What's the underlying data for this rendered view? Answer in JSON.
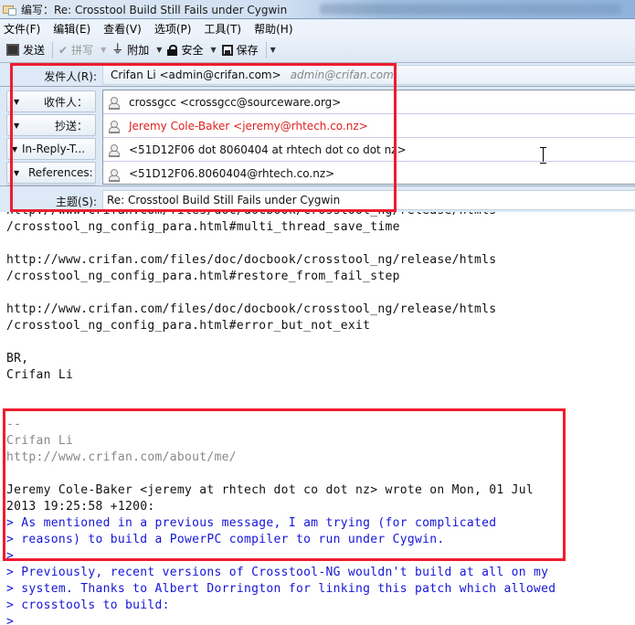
{
  "window": {
    "title": "编写：Re: Crosstool Build Still Fails under Cygwin",
    "app_icon": "compose-envelope-icon"
  },
  "menu": {
    "items": [
      "文件(F)",
      "编辑(E)",
      "查看(V)",
      "选项(P)",
      "工具(T)",
      "帮助(H)"
    ]
  },
  "toolbar": {
    "send_label": "发送",
    "spell_label": "拼写",
    "attach_label": "附加",
    "security_label": "安全",
    "save_label": "保存",
    "dropdown_glyph": "▼"
  },
  "header": {
    "from_label": "发件人(R):",
    "from_value": "Crifan Li <admin@crifan.com>",
    "from_alt": "admin@crifan.com",
    "recipients": [
      {
        "type_label": "收件人：",
        "value": "crossgcc <crossgcc@sourceware.org>",
        "highlight": false
      },
      {
        "type_label": "抄送：",
        "value": "Jeremy Cole-Baker <jeremy@rhtech.co.nz>",
        "highlight": true
      },
      {
        "type_label": "In-Reply-T...",
        "value": "<51D12F06 dot 8060404 at rhtech dot co dot nz>",
        "highlight": false
      },
      {
        "type_label": "References:",
        "value": "<51D12F06.8060404@rhtech.co.nz>",
        "highlight": false
      }
    ],
    "subject_label": "主题(S):",
    "subject_value": "Re: Crosstool Build Still Fails under Cygwin"
  },
  "body": {
    "lines": [
      {
        "text": "http://www.crifan.com/files/doc/docbook/crosstool_ng/release/htmls",
        "style": "cut"
      },
      {
        "text": "/crosstool_ng_config_para.html#multi_thread_save_time",
        "style": "normal"
      },
      {
        "text": "",
        "style": "normal"
      },
      {
        "text": "http://www.crifan.com/files/doc/docbook/crosstool_ng/release/htmls",
        "style": "normal"
      },
      {
        "text": "/crosstool_ng_config_para.html#restore_from_fail_step",
        "style": "normal"
      },
      {
        "text": "",
        "style": "normal"
      },
      {
        "text": "http://www.crifan.com/files/doc/docbook/crosstool_ng/release/htmls",
        "style": "normal"
      },
      {
        "text": "/crosstool_ng_config_para.html#error_but_not_exit",
        "style": "normal"
      },
      {
        "text": "",
        "style": "normal"
      },
      {
        "text": "BR,",
        "style": "normal"
      },
      {
        "text": "Crifan Li",
        "style": "normal"
      },
      {
        "text": "",
        "style": "normal"
      },
      {
        "text": "",
        "style": "normal"
      },
      {
        "text": "--",
        "style": "sig"
      },
      {
        "text": "Crifan Li",
        "style": "sig"
      },
      {
        "text": "http://www.crifan.com/about/me/",
        "style": "sig"
      },
      {
        "text": "",
        "style": "normal"
      },
      {
        "text": "Jeremy Cole-Baker <jeremy at rhtech dot co dot nz> wrote on Mon, 01 Jul",
        "style": "normal"
      },
      {
        "text": "2013 19:25:58 +1200:",
        "style": "normal"
      },
      {
        "text": "> As mentioned in a previous message, I am trying (for complicated",
        "style": "quote"
      },
      {
        "text": "> reasons) to build a PowerPC compiler to run under Cygwin.",
        "style": "quote"
      },
      {
        "text": ">",
        "style": "quote"
      },
      {
        "text": "> Previously, recent versions of Crosstool-NG wouldn't build at all on my",
        "style": "quote"
      },
      {
        "text": "> system. Thanks to Albert Dorrington for linking this patch which allowed",
        "style": "quote"
      },
      {
        "text": "> crosstools to build:",
        "style": "quote"
      },
      {
        "text": ">",
        "style": "quote"
      }
    ]
  },
  "colors": {
    "quote": "#1515d8",
    "signature": "#888888",
    "cc_highlight": "#e02020",
    "annotation": "#ee1c2e"
  }
}
